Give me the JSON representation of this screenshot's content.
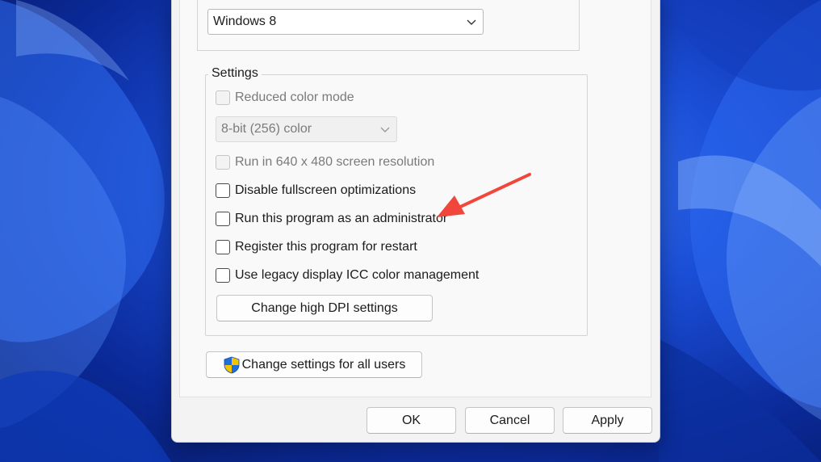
{
  "compatibility": {
    "os_selected": "Windows 8"
  },
  "settings": {
    "legend": "Settings",
    "reduced_color": {
      "label": "Reduced color mode",
      "checked": false,
      "disabled": true
    },
    "color_depth": {
      "value": "8-bit (256) color",
      "disabled": true
    },
    "resolution_640": {
      "label": "Run in 640 x 480 screen resolution",
      "checked": false,
      "disabled": true
    },
    "disable_fullscreen": {
      "label": "Disable fullscreen optimizations",
      "checked": false
    },
    "run_as_admin": {
      "label": "Run this program as an administrator",
      "checked": false
    },
    "register_restart": {
      "label": "Register this program for restart",
      "checked": false
    },
    "legacy_icc": {
      "label": "Use legacy display ICC color management",
      "checked": false
    },
    "high_dpi_button": "Change high DPI settings"
  },
  "all_users_button": "Change settings for all users",
  "footer": {
    "ok": "OK",
    "cancel": "Cancel",
    "apply": "Apply"
  },
  "colors": {
    "annotation_arrow": "#f0463c",
    "shield_blue": "#1e6fd9",
    "shield_yellow": "#f5c400"
  }
}
